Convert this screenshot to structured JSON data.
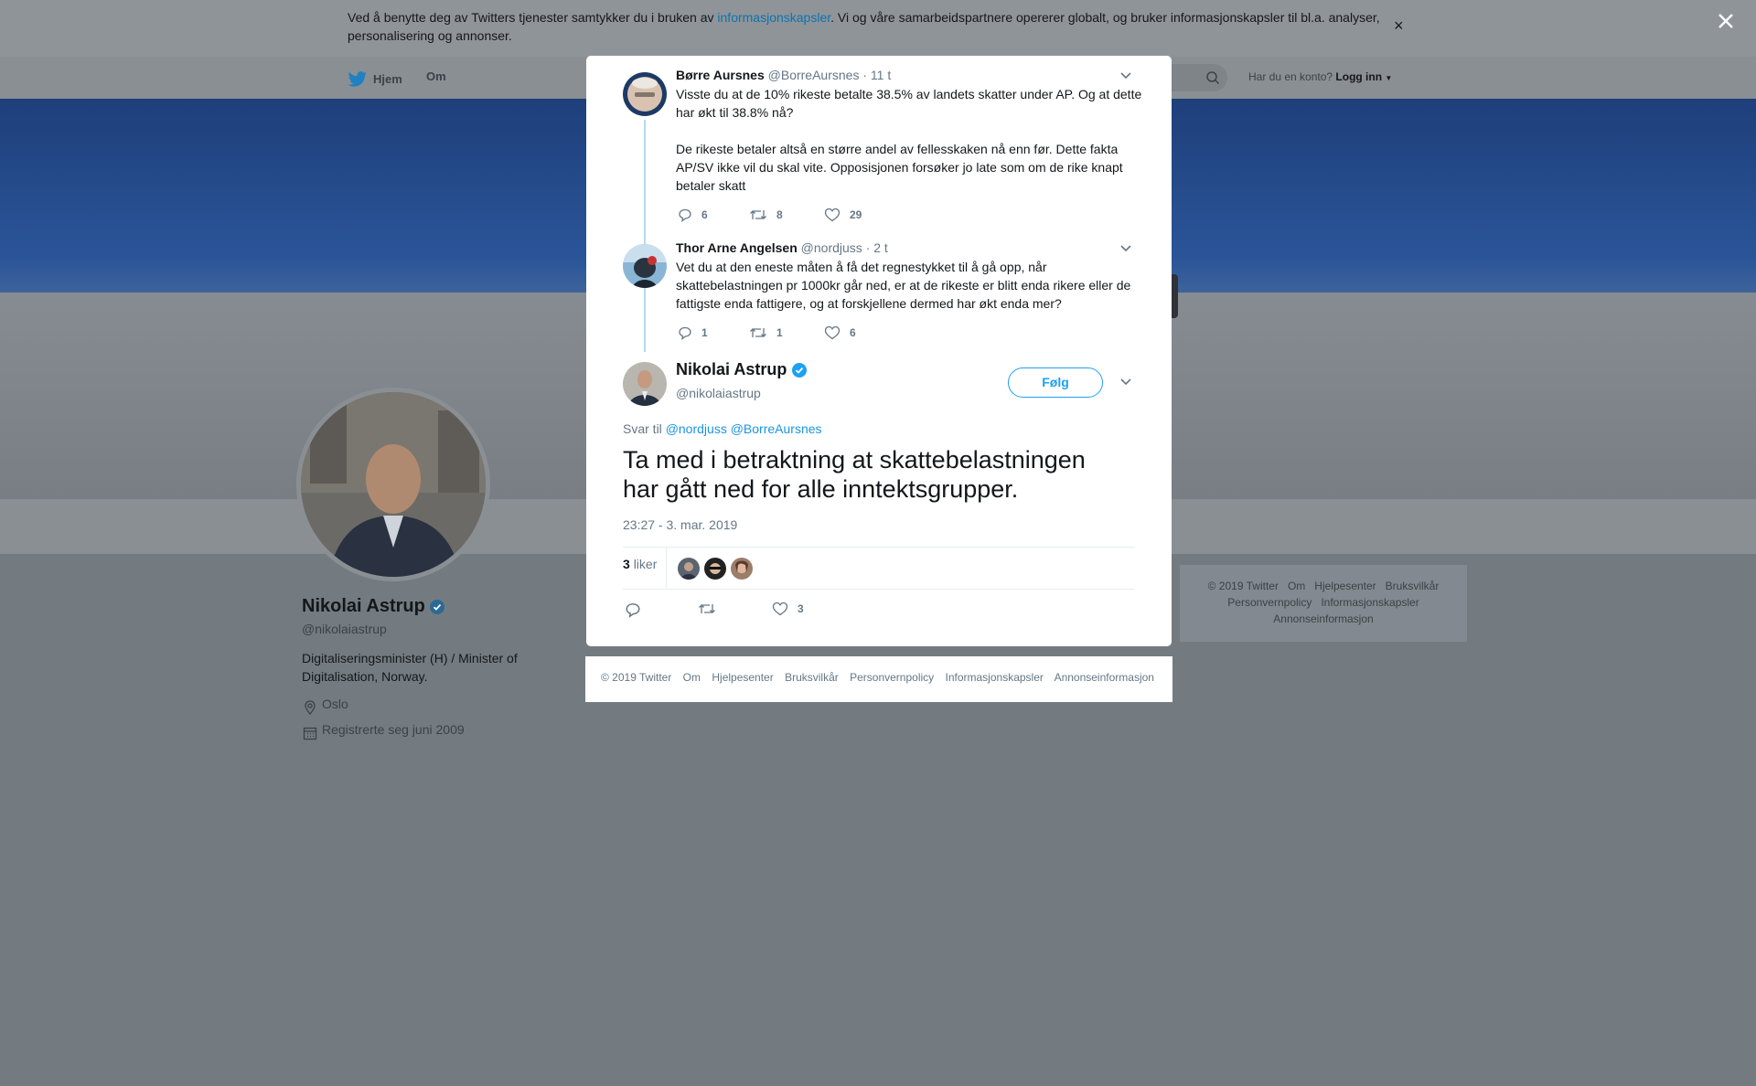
{
  "cookie_bar": {
    "text_before": "Ved å benytte deg av Twitters tjenester samtykker du i bruken av ",
    "link": "informasjonskapsler",
    "text_after": ". Vi og våre samarbeidspartnere opererer globalt, og bruker informasjonskapsler til bl.a. analyser, personalisering og annonser.",
    "close": "×"
  },
  "nav": {
    "home": "Hjem",
    "about": "Om",
    "account_prompt": "Har du en konto?",
    "login": "Logg inn"
  },
  "profile": {
    "name": "Nikolai Astrup",
    "handle": "@nikolaiastrup",
    "bio": "Digitaliseringsminister (H) / Minister of Digitalisation, Norway.",
    "location": "Oslo",
    "joined": "Registrerte seg juni 2009"
  },
  "footer_right": [
    "© 2019 Twitter",
    "Om",
    "Hjelpesenter",
    "Bruksvilkår",
    "Personvernpolicy",
    "Informasjonskapsler",
    "Annonseinformasjon"
  ],
  "modal": {
    "tweets": [
      {
        "name": "Børre Aursnes",
        "handle": "@BorreAursnes",
        "time": "· 11 t",
        "text": "Visste du at de 10% rikeste betalte 38.5% av landets skatter under AP. Og at dette har økt til 38.8% nå?\n\nDe rikeste betaler altså en større andel av fellesskaken nå enn før. Dette fakta AP/SV ikke vil du skal vite. Opposisjonen forsøker jo late som om de rike knapt betaler skatt",
        "replies": "6",
        "retweets": "8",
        "likes": "29"
      },
      {
        "name": "Thor Arne Angelsen",
        "handle": "@nordjuss",
        "time": "· 2 t",
        "text": "Vet du at den eneste måten å få det regnestykket til å gå opp, når skattebelastningen pr 1000kr går ned, er at de rikeste er blitt enda rikere eller de fattigste enda fattigere, og at forskjellene dermed har økt enda mer?",
        "replies": "1",
        "retweets": "1",
        "likes": "6"
      }
    ],
    "main": {
      "name": "Nikolai Astrup",
      "handle": "@nikolaiastrup",
      "follow": "Følg",
      "reply_prefix": "Svar til",
      "reply_to_1": "@nordjuss",
      "reply_to_2": "@BorreAursnes",
      "text": "Ta med i betraktning at skattebelastningen har gått ned for alle inntektsgrupper.",
      "timestamp": "23:27 - 3. mar. 2019",
      "likes_count": "3",
      "likes_label": "liker",
      "action_likes": "3"
    },
    "footer": [
      "© 2019 Twitter",
      "Om",
      "Hjelpesenter",
      "Bruksvilkår",
      "Personvernpolicy",
      "Informasjonskapsler",
      "Annonseinformasjon"
    ]
  },
  "colors": {
    "accent": "#1da1f2",
    "link": "#1b95e0",
    "verified": "#1da1f2",
    "overlay": "#737b80"
  }
}
